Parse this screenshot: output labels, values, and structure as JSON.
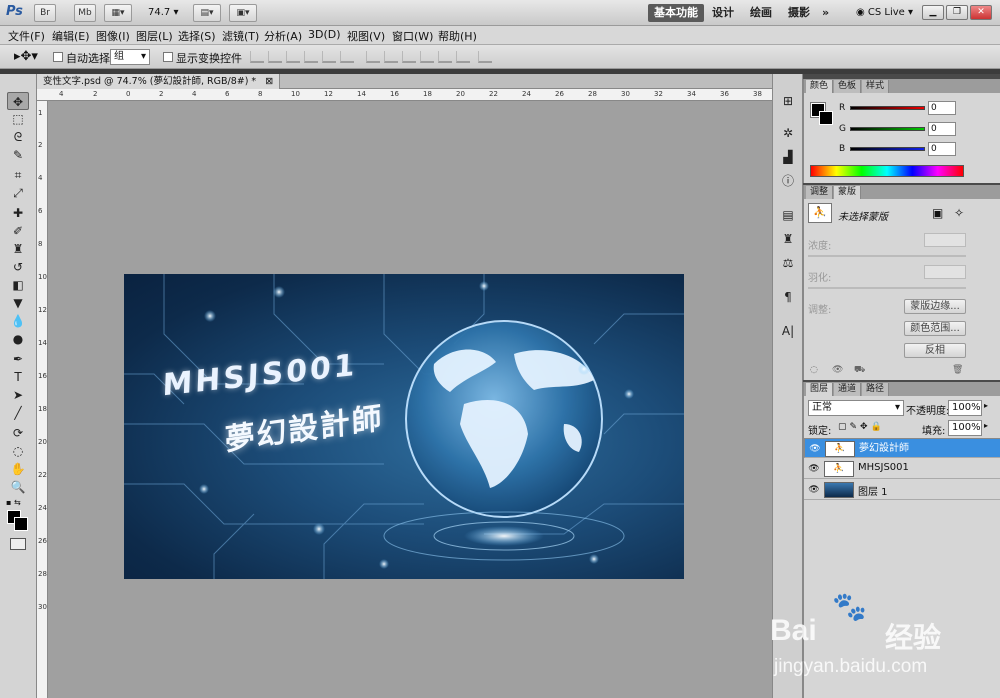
{
  "appbar": {
    "logo": "Ps",
    "btn_br": "Br",
    "btn_mb": "Mb",
    "zoom": "74.7",
    "workspaces": [
      "基本功能",
      "设计",
      "绘画",
      "摄影"
    ],
    "more": "»",
    "cslive": "CS Live"
  },
  "menubar": [
    "文件(F)",
    "编辑(E)",
    "图像(I)",
    "图层(L)",
    "选择(S)",
    "滤镜(T)",
    "分析(A)",
    "3D(D)",
    "视图(V)",
    "窗口(W)",
    "帮助(H)"
  ],
  "options": {
    "auto_select_label": "自动选择:",
    "auto_select_value": "组",
    "show_transform_label": "显示变换控件"
  },
  "document": {
    "tab_title": "变性文字.psd @ 74.7% (夢幻設計師, RGB/8#) *",
    "ruler_h": [
      "4",
      "2",
      "0",
      "2",
      "4",
      "6",
      "8",
      "10",
      "12",
      "14",
      "16",
      "18",
      "20",
      "22",
      "24",
      "26",
      "28",
      "30",
      "32",
      "34",
      "36",
      "38"
    ],
    "ruler_v": [
      "1",
      "2",
      "4",
      "6",
      "8",
      "10",
      "12",
      "14",
      "16",
      "18",
      "20",
      "22",
      "24",
      "26",
      "28",
      "30"
    ],
    "artwork_line1": "MHSJS001",
    "artwork_line2": "夢幻設計師"
  },
  "color_panel": {
    "tabs": [
      "颜色",
      "色板",
      "样式"
    ],
    "channels": [
      {
        "label": "R",
        "value": "0",
        "color": "#d40000"
      },
      {
        "label": "G",
        "value": "0",
        "color": "#00b000"
      },
      {
        "label": "B",
        "value": "0",
        "color": "#1020d0"
      }
    ]
  },
  "adjust_panel": {
    "tabs": [
      "调整",
      "蒙版"
    ],
    "mask_status": "未选择蒙版",
    "density_label": "浓度:",
    "feather_label": "羽化:",
    "refine_label": "调整:",
    "btn_mask_edge": "蒙版边缘...",
    "btn_color_range": "颜色范围...",
    "btn_invert": "反相"
  },
  "layers_panel": {
    "tabs": [
      "图层",
      "通道",
      "路径"
    ],
    "blend_mode": "正常",
    "opacity_label": "不透明度:",
    "opacity_value": "100%",
    "lock_label": "锁定:",
    "fill_label": "填充:",
    "fill_value": "100%",
    "layers": [
      {
        "name": "夢幻設計師",
        "selected": true
      },
      {
        "name": "MHSJS001",
        "selected": false
      },
      {
        "name": "图层 1",
        "selected": false
      }
    ]
  },
  "watermark": {
    "brand": "Bai",
    "brand2": "经验",
    "url": "jingyan.baidu.com"
  }
}
